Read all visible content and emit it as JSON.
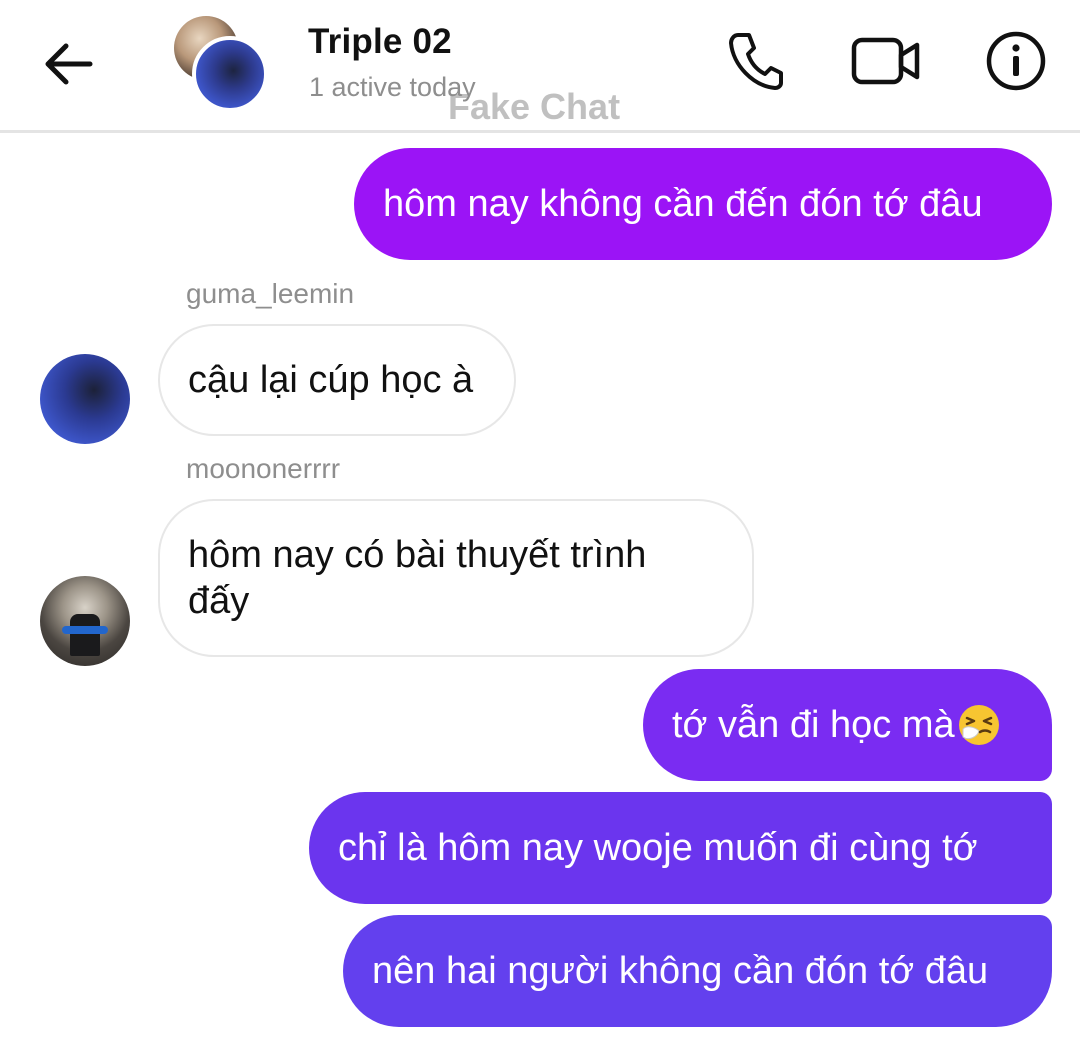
{
  "header": {
    "title": "Triple 02",
    "status": "1 active today",
    "watermark": "Fake Chat",
    "icons": {
      "back": "arrow-left-icon",
      "call": "phone-icon",
      "video": "video-camera-icon",
      "info": "info-icon"
    }
  },
  "messages": [
    {
      "direction": "outgoing",
      "text": "hôm nay không cần đến đón tớ đâu"
    },
    {
      "direction": "incoming",
      "sender": "guma_leemin",
      "text": "cậu lại cúp học à"
    },
    {
      "direction": "incoming",
      "sender": "moononerrrr",
      "text": "hôm nay có bài thuyết trình đấy"
    },
    {
      "direction": "outgoing",
      "text": "tớ vẫn đi học mà",
      "emoji": "sneezing-face-emoji"
    },
    {
      "direction": "outgoing",
      "text": "chỉ là hôm nay wooje muốn đi cùng tớ"
    },
    {
      "direction": "outgoing",
      "text": "nên hai người không cần đón tớ đâu"
    }
  ],
  "colors": {
    "bubble_1": "#9b14f6",
    "bubble_4": "#7a2cf2",
    "bubble_5": "#6b35ee",
    "bubble_6": "#6340ee",
    "incoming_bubble_border": "#e7e7e7",
    "muted_text": "#8e8e8e"
  }
}
